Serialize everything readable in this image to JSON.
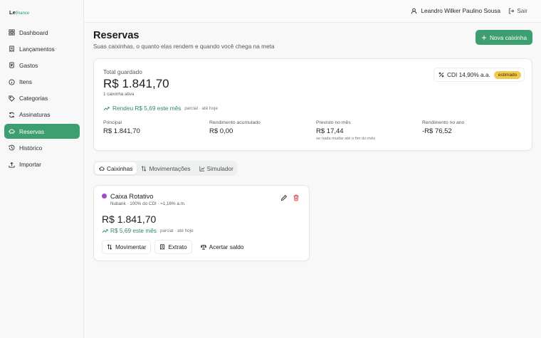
{
  "brand": {
    "prefix": "Le",
    "suffix": "finance"
  },
  "sidebar": {
    "items": [
      {
        "label": "Dashboard",
        "icon": "layout-icon"
      },
      {
        "label": "Lançamentos",
        "icon": "receipt-icon"
      },
      {
        "label": "Gastos",
        "icon": "file-icon"
      },
      {
        "label": "Itens",
        "icon": "info-icon"
      },
      {
        "label": "Categorias",
        "icon": "tag-icon"
      },
      {
        "label": "Assinaturas",
        "icon": "refresh-icon"
      },
      {
        "label": "Reservas",
        "icon": "piggy-icon",
        "active": true
      },
      {
        "label": "Histórico",
        "icon": "history-icon"
      },
      {
        "label": "Importar",
        "icon": "upload-icon"
      }
    ]
  },
  "header": {
    "user_name": "Leandro Wilker Paulino Sousa",
    "logout_label": "Sair"
  },
  "page": {
    "title": "Reservas",
    "subtitle": "Suas caixinhas, o quanto elas rendem e quando você chega na meta",
    "new_button": "Nova caixinha"
  },
  "summary": {
    "total_label": "Total guardado",
    "total_value": "R$ 1.841,70",
    "active_count": "1 caixinha ativa",
    "earned_text": "Rendeu R$ 5,69 este mês",
    "earned_note": "parcial · até hoje",
    "cdi_label": "CDI 14,90% a.a.",
    "cdi_badge": "estimado",
    "metrics": [
      {
        "label": "Principal",
        "value": "R$ 1.841,70",
        "note": ""
      },
      {
        "label": "Rendimento acumulado",
        "value": "R$ 0,00",
        "note": "",
        "color": "#2e8b60"
      },
      {
        "label": "Previsto no mês",
        "value": "R$ 17,44",
        "note": "se nada mudar até o fim do mês"
      },
      {
        "label": "Rendimento no ano",
        "value": "-R$ 76,52",
        "note": ""
      }
    ]
  },
  "tabs": [
    {
      "label": "Caixinhas",
      "active": true
    },
    {
      "label": "Movimentações"
    },
    {
      "label": "Simulador"
    }
  ],
  "box": {
    "color": "#a24bc9",
    "name": "Caixa Rotativo",
    "meta": "Nubank · 100% do CDI · ≈1,16% a.m.",
    "value": "R$ 1.841,70",
    "earned_text": "R$ 5,69 este mês",
    "earned_note": "parcial · até hoje",
    "actions": [
      "Movimentar",
      "Extrato",
      "Acertar saldo"
    ]
  }
}
